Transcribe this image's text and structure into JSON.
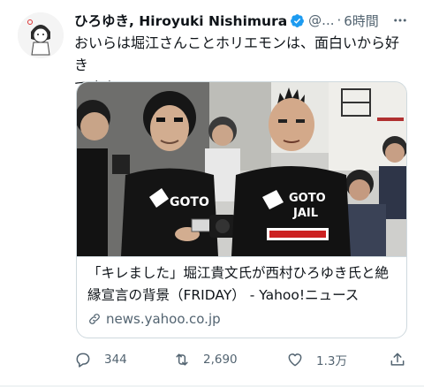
{
  "tweet": {
    "display_name": "ひろゆき, Hiroyuki Nishimura",
    "handle": "@...",
    "separator": "·",
    "time": "6時間",
    "text_line1": "おいらは堀江さんことホリエモンは、面白いから好き",
    "text_line2": "ですよ。"
  },
  "card": {
    "shirt_line1": "GOTO",
    "shirt_line2": "JAIL",
    "title_line1": "「キレました」堀江貴文氏が西村ひろゆき氏と絶",
    "title_line2": "縁宣言の背景（FRIDAY） - Yahoo!ニュース",
    "domain": "news.yahoo.co.jp"
  },
  "actions": {
    "reply_count": "344",
    "retweet_count": "2,690",
    "like_count": "1.3万"
  },
  "colors": {
    "accent": "#1d9bf0",
    "text": "#0f1419",
    "secondary": "#536471",
    "border": "#cfd9de"
  },
  "icons": [
    "verified-badge-icon",
    "more-icon",
    "link-icon",
    "reply-icon",
    "retweet-icon",
    "like-icon",
    "share-icon"
  ]
}
